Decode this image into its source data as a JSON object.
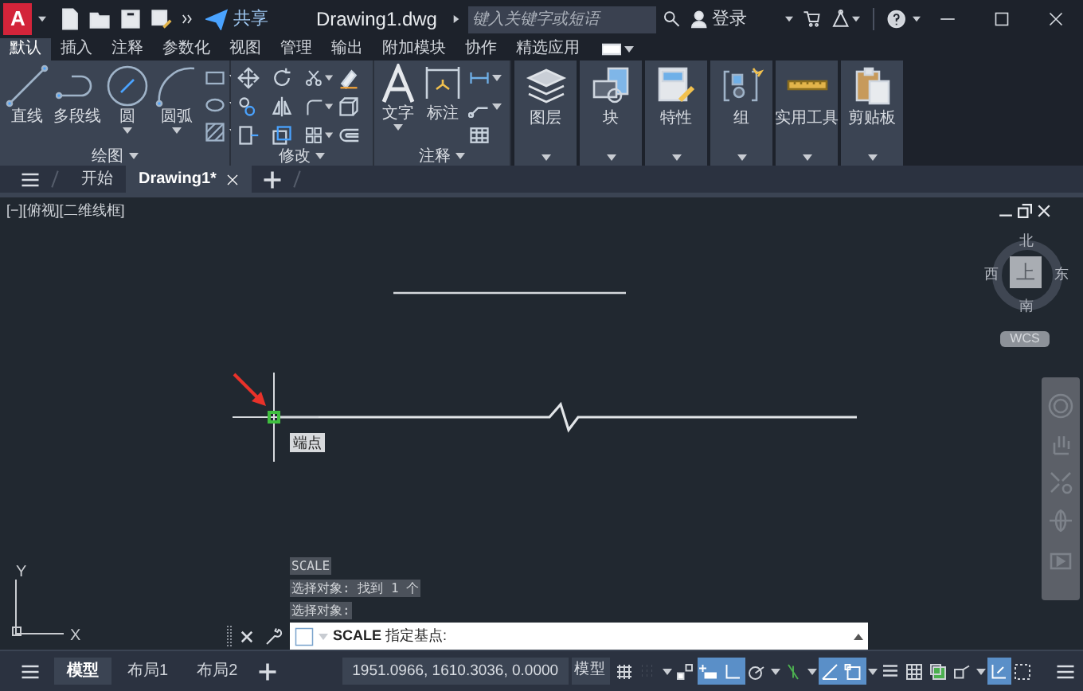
{
  "title_bar": {
    "logo": "A",
    "share": "共享",
    "title": "Drawing1.dwg",
    "search": {
      "placeholder": "键入关键字或短语"
    },
    "login": "登录"
  },
  "ribbon_tabs": [
    {
      "label": "默认",
      "selected": true
    },
    {
      "label": "插入",
      "selected": false
    },
    {
      "label": "注释",
      "selected": false
    },
    {
      "label": "参数化",
      "selected": false
    },
    {
      "label": "视图",
      "selected": false
    },
    {
      "label": "管理",
      "selected": false
    },
    {
      "label": "输出",
      "selected": false
    },
    {
      "label": "附加模块",
      "selected": false
    },
    {
      "label": "协作",
      "selected": false
    },
    {
      "label": "精选应用",
      "selected": false
    }
  ],
  "draw_panel": {
    "title": "绘图",
    "tools": [
      {
        "kind": "line",
        "label": "直线",
        "dropdown": false
      },
      {
        "kind": "polyline",
        "label": "多段线",
        "dropdown": false
      },
      {
        "kind": "circle",
        "label": "圆",
        "dropdown": true
      },
      {
        "kind": "arc",
        "label": "圆弧",
        "dropdown": true
      }
    ]
  },
  "modify_panel": {
    "title": "修改"
  },
  "annotation_panel": {
    "title": "注释",
    "tools": [
      {
        "kind": "text",
        "label": "文字"
      },
      {
        "kind": "dimension",
        "label": "标注"
      }
    ]
  },
  "large_panels": [
    {
      "kind": "layers",
      "label": "图层"
    },
    {
      "kind": "block",
      "label": "块"
    },
    {
      "kind": "properties",
      "label": "特性"
    },
    {
      "kind": "group",
      "label": "组"
    },
    {
      "kind": "utilities",
      "label": "实用工具"
    },
    {
      "kind": "clipboard",
      "label": "剪贴板"
    }
  ],
  "file_tabs": [
    {
      "label": "开始",
      "selected": false,
      "closable": false
    },
    {
      "label": "Drawing1*",
      "selected": true,
      "closable": true
    }
  ],
  "viewport_label": "[−][俯视][二维线框]",
  "viewcube": {
    "north": "北",
    "south": "南",
    "east": "东",
    "west": "西",
    "face": "上",
    "ucs": "WCS"
  },
  "snap_tooltip": "端点",
  "command_history": [
    "SCALE",
    "选择对象: 找到 1 个",
    "选择对象:"
  ],
  "command_line": {
    "text": "**SCALE** 指定基点:"
  },
  "ucs_icon": {
    "x": "X",
    "y": "Y"
  },
  "layout_tabs": [
    {
      "label": "模型",
      "selected": true
    },
    {
      "label": "布局1",
      "selected": false
    },
    {
      "label": "布局2",
      "selected": false
    }
  ],
  "status_bar": {
    "coordinates": "1951.0966, 1610.3036, 0.0000",
    "space": "模型",
    "toggles": [
      {
        "kind": "grid",
        "on": false
      },
      {
        "kind": "snap",
        "on": false
      },
      {
        "kind": "infer",
        "on": false
      },
      {
        "kind": "dynamic",
        "on": true
      },
      {
        "kind": "ortho",
        "on": true
      },
      {
        "kind": "polar",
        "on": false
      },
      {
        "kind": "isodraft",
        "on": false
      },
      {
        "kind": "tracking",
        "on": true
      },
      {
        "kind": "osnap",
        "on": true
      },
      {
        "kind": "lineweight",
        "on": false
      },
      {
        "kind": "transparency",
        "on": false
      },
      {
        "kind": "selection",
        "on": false
      },
      {
        "kind": "gizmo",
        "on": false
      },
      {
        "kind": "annomonitor",
        "on": true
      },
      {
        "kind": "units",
        "on": false
      }
    ]
  }
}
